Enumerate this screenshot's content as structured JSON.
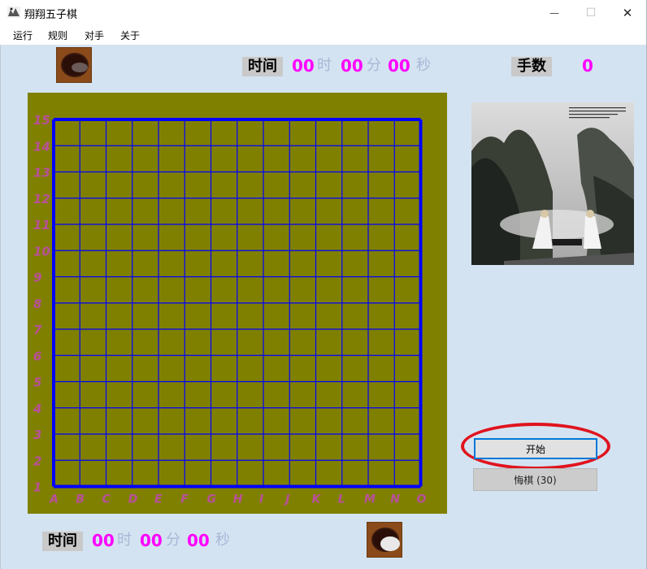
{
  "window": {
    "title": "翔翔五子棋",
    "minimize_glyph": "—",
    "maximize_glyph": "☐",
    "close_glyph": "✕"
  },
  "menu": {
    "items": [
      "运行",
      "规则",
      "对手",
      "关于"
    ]
  },
  "top_timer": {
    "label": "时间",
    "hours": "00",
    "hours_unit": "时",
    "minutes": "00",
    "minutes_unit": "分",
    "seconds": "00",
    "seconds_unit": "秒"
  },
  "moves": {
    "label": "手数",
    "value": "0"
  },
  "bottom_timer": {
    "label": "时间",
    "hours": "00",
    "hours_unit": "时",
    "minutes": "00",
    "minutes_unit": "分",
    "seconds": "00",
    "seconds_unit": "秒"
  },
  "board": {
    "size": 15,
    "row_labels": [
      "15",
      "14",
      "13",
      "12",
      "11",
      "10",
      "9",
      "8",
      "7",
      "6",
      "5",
      "4",
      "3",
      "2",
      "1"
    ],
    "col_labels": [
      "A",
      "B",
      "C",
      "D",
      "E",
      "F",
      "G",
      "H",
      "I",
      "J",
      "K",
      "L",
      "M",
      "N",
      "O"
    ]
  },
  "buttons": {
    "start": "开始",
    "undo": "悔棋 (30)"
  },
  "icons": {
    "app": "gomoku-app-icon",
    "black_bowl": "black-stone-bowl-icon",
    "white_bowl": "white-stone-bowl-icon"
  },
  "colors": {
    "board": "#808000",
    "grid": "#0000ff",
    "coord_label": "#b8509a",
    "timer_number": "#ff00ff",
    "timer_unit": "#a8b8d8",
    "highlight": "#e0141e",
    "background": "#d4e3f1"
  }
}
